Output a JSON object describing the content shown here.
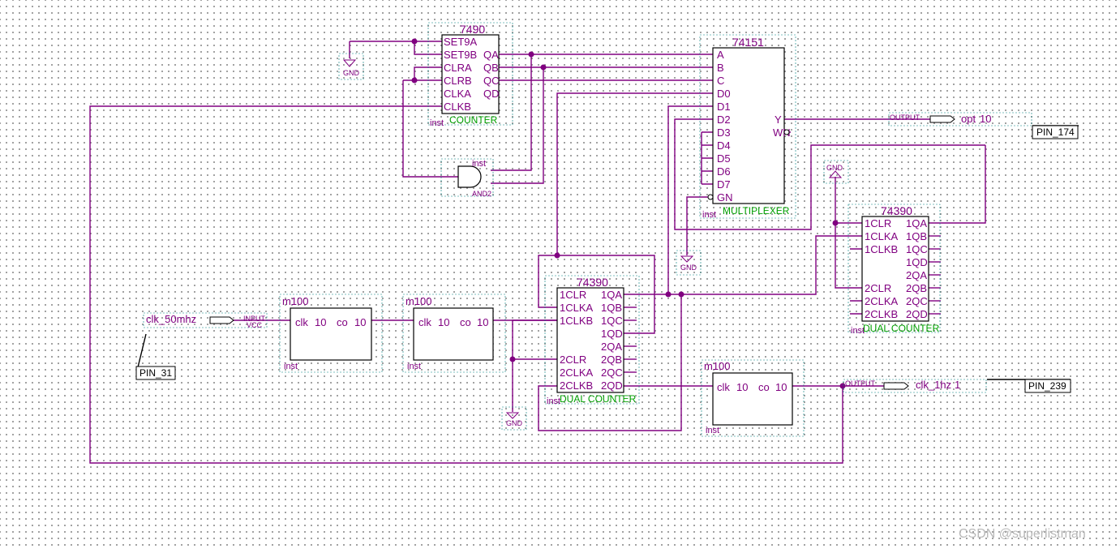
{
  "colors": {
    "wire": "#800080",
    "body": "#000000",
    "symbol_label": "#00a000",
    "bbox": "#008080",
    "background": "#ffffff"
  },
  "counter_7490": {
    "title": "7490",
    "inst": "inst",
    "sublabel": "COUNTER",
    "ports_left": [
      "SET9A",
      "SET9B",
      "CLRA",
      "CLRB",
      "CLKA",
      "CLKB"
    ],
    "ports_right": [
      "QA",
      "QB",
      "QC",
      "QD"
    ]
  },
  "mux_74151": {
    "title": "74151",
    "inst": "inst",
    "sublabel": "MULTIPLEXER",
    "ports_left": [
      "A",
      "B",
      "C",
      "D0",
      "D1",
      "D2",
      "D3",
      "D4",
      "D5",
      "D6",
      "D7",
      "GN"
    ],
    "ports_right": [
      "Y",
      "WN"
    ]
  },
  "and_gate": {
    "inst": "inst",
    "label": "AND2"
  },
  "gnd_label": "GND",
  "output_pin": {
    "type": "OUTPUT",
    "name": "opt",
    "bus": "10",
    "pin": "PIN_174"
  },
  "input_pin": {
    "name": "clk_50mhz",
    "type": "INPUT",
    "vcc": "VCC",
    "pin": "PIN_31"
  },
  "clk_output": {
    "type": "OUTPUT",
    "name": "clk_1hz",
    "bus": "1",
    "pin": "PIN_239"
  },
  "m100_blocks": [
    {
      "title": "m100",
      "inst": "inst",
      "clk": "clk",
      "clk_w": "10",
      "co": "co",
      "co_w": "10"
    },
    {
      "title": "m100",
      "inst": "inst",
      "clk": "clk",
      "clk_w": "10",
      "co": "co",
      "co_w": "10"
    },
    {
      "title": "m100",
      "inst": "inst",
      "clk": "clk",
      "clk_w": "10",
      "co": "co",
      "co_w": "10"
    }
  ],
  "dual_counter_1": {
    "title": "74390",
    "inst": "inst",
    "sublabel": "DUAL COUNTER",
    "ports_left": [
      "1CLR",
      "1CLKA",
      "1CLKB",
      "2CLR",
      "2CLKA",
      "2CLKB"
    ],
    "ports_right": [
      "1QA",
      "1QB",
      "1QC",
      "1QD",
      "2QA",
      "2QB",
      "2QC",
      "2QD"
    ]
  },
  "dual_counter_2": {
    "title": "74390",
    "inst": "inst",
    "sublabel": "DUAL COUNTER",
    "ports_left": [
      "1CLR",
      "1CLKA",
      "1CLKB",
      "2CLR",
      "2CLKA",
      "2CLKB"
    ],
    "ports_right": [
      "1QA",
      "1QB",
      "1QC",
      "1QD",
      "2QA",
      "2QB",
      "2QC",
      "2QD"
    ]
  },
  "watermark": "CSDN @superlistman"
}
